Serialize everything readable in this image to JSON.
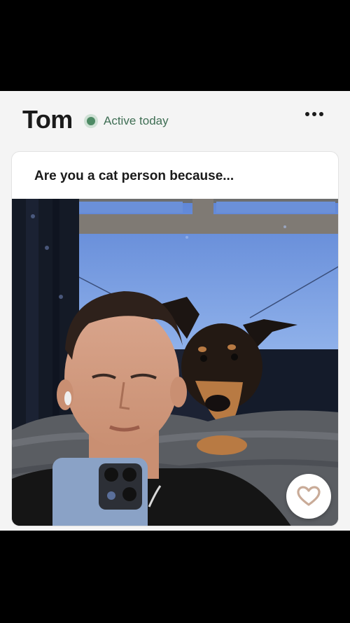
{
  "profile": {
    "name": "Tom",
    "status": "Active today"
  },
  "card": {
    "prompt": "Are you a cat person because..."
  },
  "icons": {
    "menu": "more-horizontal-icon",
    "like": "heart-outline-icon",
    "status": "active-dot-icon"
  },
  "colors": {
    "active_green": "#4d8a64",
    "heart_stroke": "#c9ab98"
  }
}
